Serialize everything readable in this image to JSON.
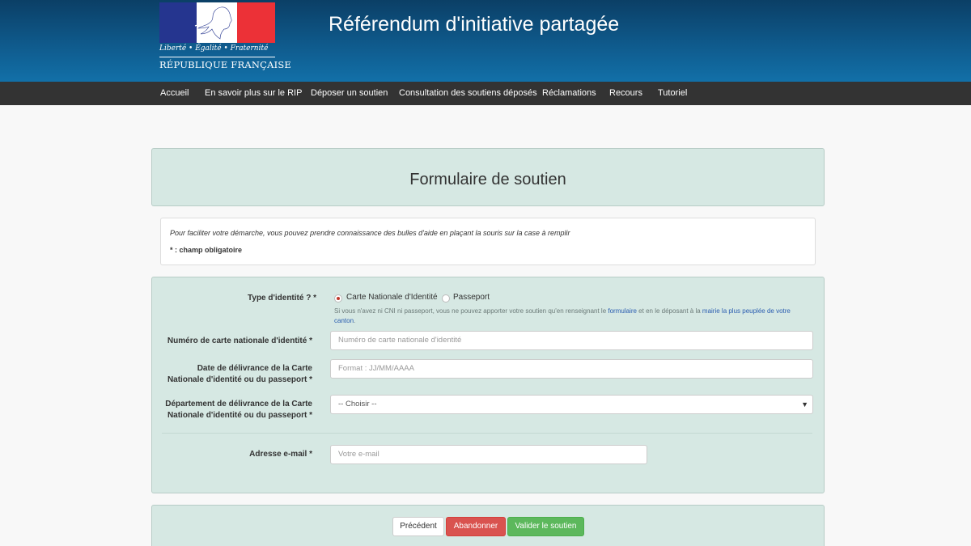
{
  "header": {
    "motto": "Liberté • Égalité • Fraternité",
    "republic": "RÉPUBLIQUE FRANÇAISE",
    "title": "Référendum d'initiative partagée"
  },
  "nav": {
    "items": [
      {
        "label": "Accueil"
      },
      {
        "label": "En savoir plus sur le RIP"
      },
      {
        "label": "Déposer un soutien"
      },
      {
        "label": "Consultation des soutiens déposés"
      },
      {
        "label": "Réclamations"
      },
      {
        "label": "Recours"
      },
      {
        "label": "Tutoriel"
      }
    ]
  },
  "form": {
    "title": "Formulaire de soutien",
    "info_text": "Pour faciliter votre démarche, vous pouvez prendre connaissance des bulles d'aide en plaçant la souris sur la case à remplir",
    "required_note": "* : champ obligatoire",
    "identity_type": {
      "label": "Type d'identité ? *",
      "options": [
        {
          "label": "Carte Nationale d'Identité",
          "selected": true
        },
        {
          "label": "Passeport",
          "selected": false
        }
      ],
      "help_before": "Si vous n'avez ni CNI ni passeport, vous ne pouvez apporter votre soutien qu'en renseignant le ",
      "help_link1": "formulaire",
      "help_middle": " et en le déposant à la ",
      "help_link2": "mairie la plus peuplée de votre canton",
      "help_after": "."
    },
    "card_number": {
      "label": "Numéro de carte nationale d'identité *",
      "placeholder": "Numéro de carte nationale d'identité"
    },
    "issue_date": {
      "label_line1": "Date de délivrance de la Carte",
      "label_line2": "Nationale d'identité ou du passeport *",
      "placeholder": "Format : JJ/MM/AAAA"
    },
    "department": {
      "label_line1": "Département de délivrance de la Carte",
      "label_line2": "Nationale d'identité ou du passeport *",
      "selected": "-- Choisir --"
    },
    "email": {
      "label": "Adresse e-mail *",
      "placeholder": "Votre e-mail"
    }
  },
  "actions": {
    "previous": "Précédent",
    "abort": "Abandonner",
    "submit": "Valider le soutien"
  },
  "colors": {
    "header_blue": "#0f5a8c",
    "navbar": "#333333",
    "panel_bg": "#d6e8e3",
    "abort": "#d9534f",
    "submit": "#5cb85c",
    "flag_blue": "#25358f",
    "flag_red": "#ec3137"
  }
}
